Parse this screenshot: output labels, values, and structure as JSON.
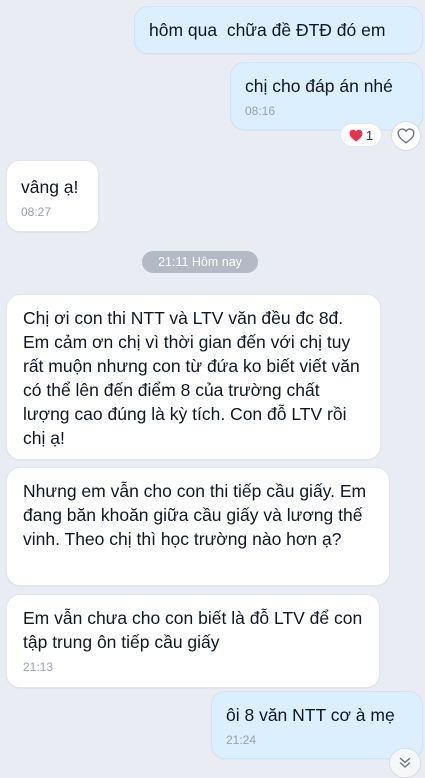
{
  "messages": [
    {
      "text": "hôm qua  chữa đề ĐTĐ đó em",
      "time": ""
    },
    {
      "text": "chị cho đáp án nhé",
      "time": "08:16"
    },
    {
      "text": "vâng ạ!",
      "time": "08:27"
    },
    {
      "text": "Chị ơi con thi NTT và LTV văn đều đc 8đ. Em cảm ơn chị vì thời gian đến với chị tuy rất muộn nhưng con từ đứa ko biết viết văn có thể lên đến điểm 8 của trường chất lượng cao đúng là kỳ tích. Con đỗ LTV rồi chị ạ!",
      "time": ""
    },
    {
      "text": "Nhưng em vẫn cho con thi tiếp cầu giấy. Em đang băn khoăn giữa cầu giấy và lương thế vinh. Theo chị thì học trường nào hơn ạ?",
      "time": ""
    },
    {
      "text": "Em vẫn chưa cho con biết là đỗ LTV để con tập trung ôn tiếp cầu giấy",
      "time": "21:13"
    },
    {
      "text": "ôi 8 văn NTT cơ à mẹ",
      "time": "21:24"
    }
  ],
  "separator": "21:11 Hôm nay",
  "reaction": {
    "emoji": "heart-icon",
    "count": "1",
    "color": "#e8334a"
  },
  "colors": {
    "outgoing": "#dcefff",
    "incoming": "#ffffff",
    "background": "#e9ecf3"
  }
}
